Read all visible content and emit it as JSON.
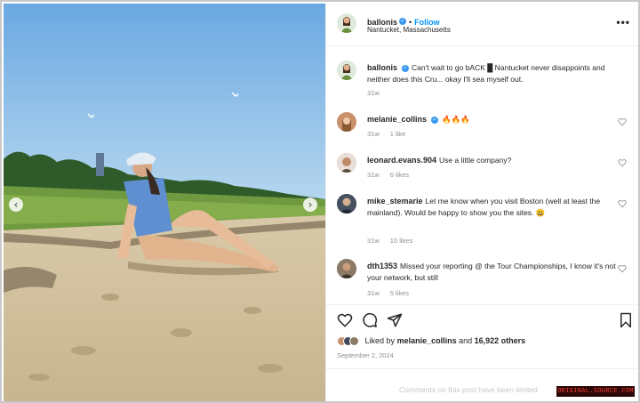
{
  "post": {
    "username": "ballonis",
    "follow_label": "Follow",
    "separator": "•",
    "location": "Nantucket, Massachusetts",
    "more_label": "•••",
    "caption_username": "ballonis",
    "caption_text": "Can't wait to go bACK █ Nantucket never disappoints and neither does this Cru... okay I'll sea myself out.",
    "caption_time": "31w"
  },
  "carousel": {
    "prev_label": "‹",
    "next_label": "›"
  },
  "comments": [
    {
      "username": "melanie_collins",
      "verified": true,
      "text": "🔥🔥🔥",
      "time": "31w",
      "likes": "1 like",
      "avatar_color": "#c9906c"
    },
    {
      "username": "leonard.evans.904",
      "verified": false,
      "text": "Use a little company?",
      "time": "31w",
      "likes": "6 likes",
      "avatar_color": "#b47a5c"
    },
    {
      "username": "mike_stemarie",
      "verified": false,
      "text": "Let me know when you visit Boston (well at least the mainland). Would be happy to show you the sites. 😃",
      "time": "31w",
      "likes": "10 likes",
      "avatar_color": "#3f4a5c"
    },
    {
      "username": "dth1353",
      "verified": false,
      "text": "Missed your reporting @ the Tour Championships, I know it's not your network, but still",
      "time": "31w",
      "likes": "5 likes",
      "avatar_color": "#7a6a5a"
    }
  ],
  "engagement": {
    "liked_by_prefix": "Liked by",
    "liked_by_user": "melanie_collins",
    "liked_by_and": "and",
    "others": "16,922 others",
    "date": "September 2, 2024",
    "comments_disabled": "Comments on this post have been limited"
  },
  "watermark": "ORIGINAL.SOURCE.COM",
  "colors": {
    "accent": "#0095f6",
    "verified": "#3897f0"
  }
}
